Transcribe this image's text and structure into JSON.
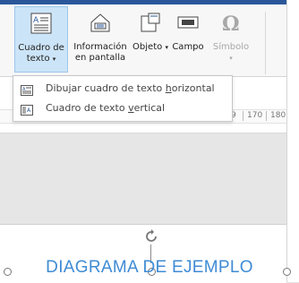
{
  "ribbon": {
    "textbox_label_1": "Cuadro de",
    "textbox_label_2": "texto",
    "info_label_1": "Información",
    "info_label_2": "en pantalla",
    "object_label": "Objeto",
    "field_label": "Campo",
    "symbol_label": "Símbolo"
  },
  "ruler": {
    "ticks": [
      "9",
      "170",
      "180"
    ]
  },
  "dropdown": {
    "item1_prefix": "Dibujar cuadro de texto ",
    "item1_key": "h",
    "item1_rest": "orizontal",
    "item2_prefix": "Cuadro de texto ",
    "item2_key": "v",
    "item2_rest": "ertical"
  },
  "document": {
    "sample_text": "DIAGRAMA DE EJEMPLO"
  },
  "colors": {
    "accent": "#2b579a",
    "selected": "#cce4f7",
    "sample_text": "#3f8bd4"
  }
}
